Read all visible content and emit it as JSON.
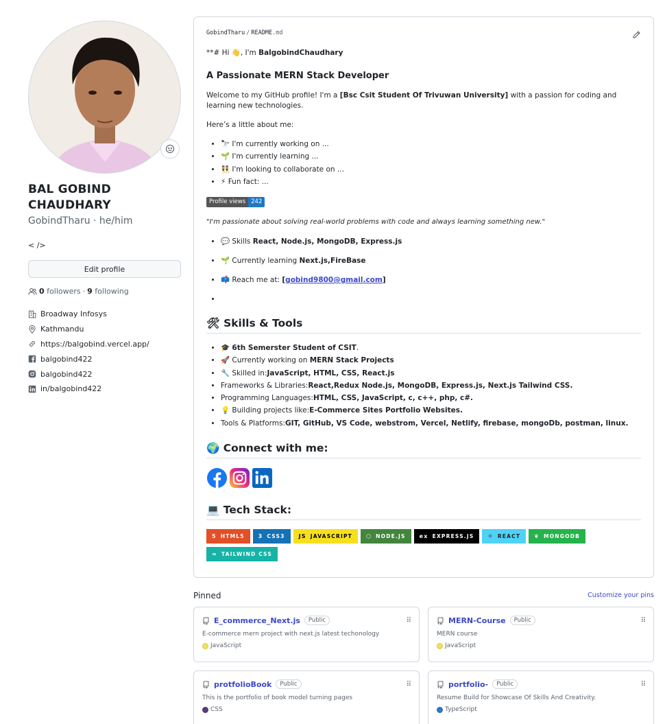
{
  "profile": {
    "name": "BAL GOBIND CHAUDHARY",
    "username_line": "GobindTharu · he/him",
    "bio": "< />",
    "edit_label": "Edit profile",
    "followers_count": "0",
    "followers_label": "followers",
    "dot": "·",
    "following_count": "9",
    "following_label": "following",
    "details": [
      {
        "icon": "organization-icon",
        "text": "Broadway Infosys"
      },
      {
        "icon": "location-icon",
        "text": "Kathmandu"
      },
      {
        "icon": "link-icon",
        "text": "https://balgobind.vercel.app/"
      },
      {
        "icon": "facebook-icon",
        "text": "balgobind422"
      },
      {
        "icon": "instagram-icon",
        "text": "balgobind422"
      },
      {
        "icon": "linkedin-icon",
        "text": "in/balgobind422"
      }
    ]
  },
  "readme": {
    "path_user": "GobindTharu",
    "path_sep": "/",
    "path_file": "README",
    "path_ext": ".md",
    "hi_prefix": "**# Hi 👋, I'm ",
    "hi_name": "BalgobindChaudhary",
    "title": "A Passionate MERN Stack Developer",
    "welcome_prefix": "Welcome to my GitHub profile! I'm a ",
    "welcome_bold": "[Bsc Csit Student Of Trivuwan University]",
    "welcome_suffix": " with a passion for coding and learning new technologies.",
    "about_intro": "Here’s a little about me:",
    "about_items": [
      "🔭 I'm currently working on ...",
      "🌱 I'm currently learning ...",
      "👯 I'm looking to collaborate on ...",
      "⚡ Fun fact: ..."
    ],
    "views_label": "Profile views",
    "views_count": "242",
    "quote": "\"I'm passionate about solving real-world problems with code and always learning something new.\"",
    "skills_prefix": "💬 Skills ",
    "skills_bold": "React, Node.js, MongoDB, Express.js",
    "learning_prefix": "🌱 Currently learning ",
    "learning_bold": "Next.js,FireBase",
    "reach_prefix": "📫 Reach me at: ",
    "reach_open": "[",
    "reach_email": "gobind9800@gmail.com",
    "reach_close": "]",
    "skills_heading": "🛠 Skills & Tools",
    "skills_list": [
      {
        "pre": "🎓 ",
        "bold": "6th Semerster Student of CSIT",
        "post": "."
      },
      {
        "pre": "🚀 Currently working on ",
        "bold": "MERN Stack Projects",
        "post": ""
      },
      {
        "pre": "🔧 Skilled in:",
        "bold": "JavaScript, HTML, CSS, React.js",
        "post": ""
      },
      {
        "pre": "Frameworks & Libraries:",
        "bold": "React,Redux Node.js, MongoDB, Express.js, Next.js Tailwind CSS.",
        "post": ""
      },
      {
        "pre": "Programming Languages:",
        "bold": "HTML, CSS, JavaScript, c, c++, php, c#.",
        "post": ""
      },
      {
        "pre": "💡 Building projects like:",
        "bold": "E-Commerce Sites Portfolio Websites.",
        "post": ""
      },
      {
        "pre": "Tools & Platforms:",
        "bold": "GIT, GitHub, VS Code, webstrom, Vercel, Netlify, firebase, mongoDb, postman, linux.",
        "post": ""
      }
    ],
    "connect_heading": "🌍 Connect with me:",
    "tech_heading": "💻 Tech Stack:",
    "tech_badges": [
      {
        "label": "HTML5",
        "glyph": "5",
        "color": "#e34f26",
        "text_color": "#ffffff"
      },
      {
        "label": "CSS3",
        "glyph": "3",
        "color": "#1572b6",
        "text_color": "#ffffff"
      },
      {
        "label": "JAVASCRIPT",
        "glyph": "JS",
        "color": "#f7df1e",
        "text_color": "#000000"
      },
      {
        "label": "NODE.JS",
        "glyph": "⬡",
        "color": "#43853d",
        "text_color": "#ffffff"
      },
      {
        "label": "EXPRESS.JS",
        "glyph": "ex",
        "color": "#000000",
        "text_color": "#ffffff"
      },
      {
        "label": "REACT",
        "glyph": "⚛",
        "color": "#20232a",
        "text_color": "#61dafb"
      },
      {
        "label": "MONGODB",
        "glyph": "❦",
        "color": "#4ea94b",
        "text_color": "#ffffff"
      },
      {
        "label": "TAILWIND CSS",
        "glyph": "≈",
        "color": "#38b2ac",
        "text_color": "#ffffff"
      }
    ]
  },
  "pinned": {
    "title": "Pinned",
    "customize": "Customize your pins",
    "repos": [
      {
        "name": "E_commerce_Next.js",
        "visibility": "Public",
        "desc": "E-commerce mern project with next.js latest techonology",
        "lang": "JavaScript",
        "lang_color": "#f1e05a"
      },
      {
        "name": "MERN-Course",
        "visibility": "Public",
        "desc": "MERN course",
        "lang": "JavaScript",
        "lang_color": "#f1e05a"
      },
      {
        "name": "protfolioBook",
        "visibility": "Public",
        "desc": "This is the portfolio of book model turning pages",
        "lang": "CSS",
        "lang_color": "#563d7c"
      },
      {
        "name": "portfolio-",
        "visibility": "Public",
        "desc": "Resume Build for Showcase Of Skills And Creativity.",
        "lang": "TypeScript",
        "lang_color": "#3178c6"
      }
    ]
  }
}
